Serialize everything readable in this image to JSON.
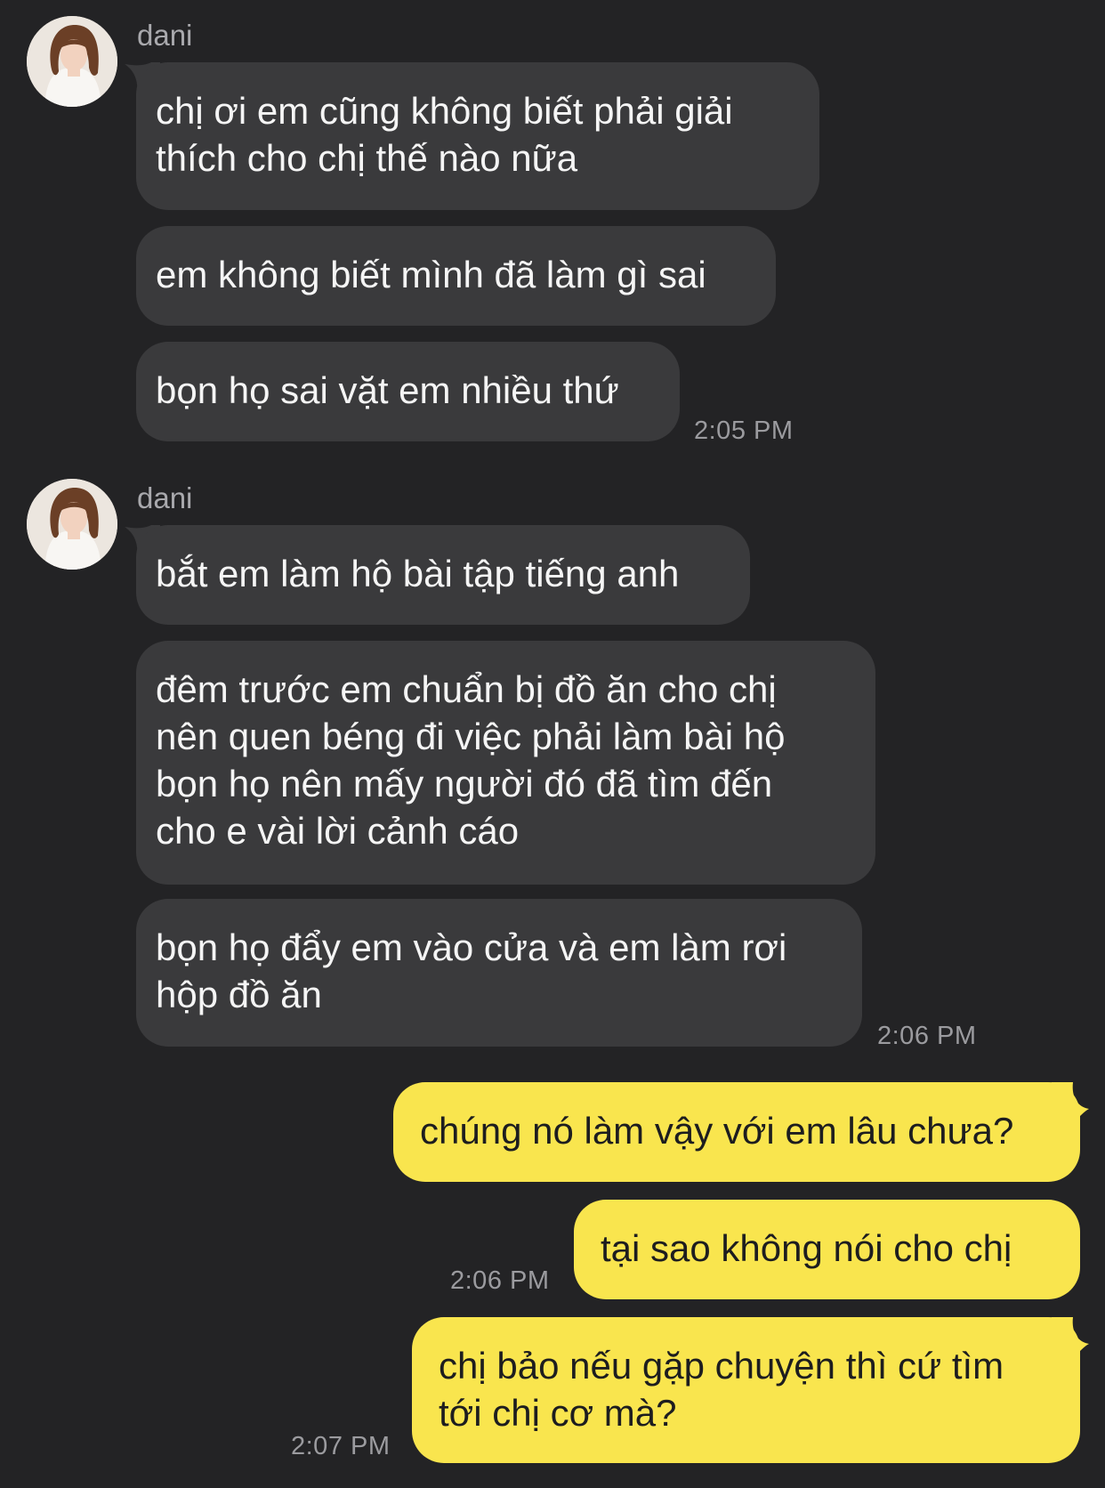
{
  "chat": {
    "group1": {
      "sender": "dani",
      "messages": [
        "chị ơi em cũng không biết phải giải\nthích cho chị thế nào nữa",
        "em không biết mình đã làm gì sai",
        "bọn họ sai vặt em nhiều thứ"
      ],
      "time": "2:05 PM"
    },
    "group2": {
      "sender": "dani",
      "messages": [
        "bắt em làm hộ bài tập tiếng anh",
        "đêm trước em chuẩn bị đồ ăn cho chị\nnên quen béng đi việc phải làm bài hộ\nbọn họ nên mấy người đó đã tìm đến\ncho e vài lời cảnh cáo",
        "bọn họ đẩy em vào cửa và em làm rơi\nhộp đồ ăn"
      ],
      "time": "2:06 PM"
    },
    "outgoing": [
      {
        "text": "chúng nó làm vậy với em lâu chưa?"
      },
      {
        "text": "tại sao không nói cho chị",
        "time": "2:06 PM"
      },
      {
        "text": "chị bảo nếu gặp chuyện thì cứ tìm\ntới chị cơ mà?",
        "time": "2:07 PM"
      }
    ]
  },
  "colors": {
    "background": "#232325",
    "incoming_bubble": "#3a3a3c",
    "outgoing_bubble": "#f9e54e",
    "incoming_text": "#f5f5f5",
    "outgoing_text": "#1d1d1f",
    "meta_text": "#9b9b9f"
  }
}
